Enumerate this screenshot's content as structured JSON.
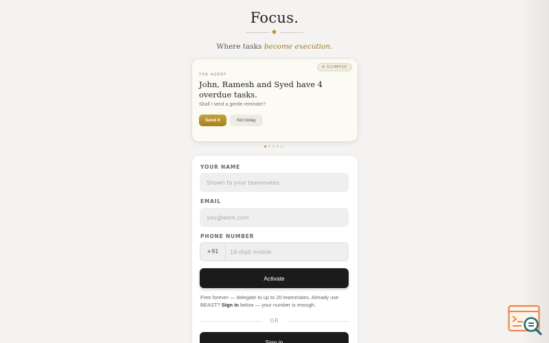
{
  "header": {
    "title": "Focus.",
    "tagline_prefix": "Where tasks ",
    "tagline_emphasis": "become execution."
  },
  "glimpse": {
    "badge": "A GLIMPSE",
    "agent_label": "THE AGENT",
    "headline": "John, Ramesh and Syed have 4 overdue tasks.",
    "subtext": "Shall I send a gentle reminder?",
    "send_label": "Send it",
    "not_today_label": "Not today",
    "carousel": {
      "count": 5,
      "active_index": 0
    }
  },
  "form": {
    "name": {
      "label": "YOUR NAME",
      "placeholder": "Shown to your teammates",
      "value": ""
    },
    "email": {
      "label": "EMAIL",
      "placeholder": "you@work.com",
      "value": ""
    },
    "phone": {
      "label": "PHONE NUMBER",
      "prefix": "+91",
      "placeholder": "10-digit mobile",
      "value": ""
    },
    "activate_label": "Activate",
    "note_before": "Free forever — delegate to up to 20 teammates. Already use BEAST? ",
    "note_link": "Sign in",
    "note_after": " below — your number is enough.",
    "divider_text": "OR",
    "signin_label": "Sign in"
  },
  "colors": {
    "accent_gold": "#b8952f",
    "dark_button": "#1b1b1b",
    "widget_orange": "#e8874a",
    "widget_teal": "#1f6f6b"
  },
  "icons": {
    "corner_widget": "code-search-icon"
  }
}
